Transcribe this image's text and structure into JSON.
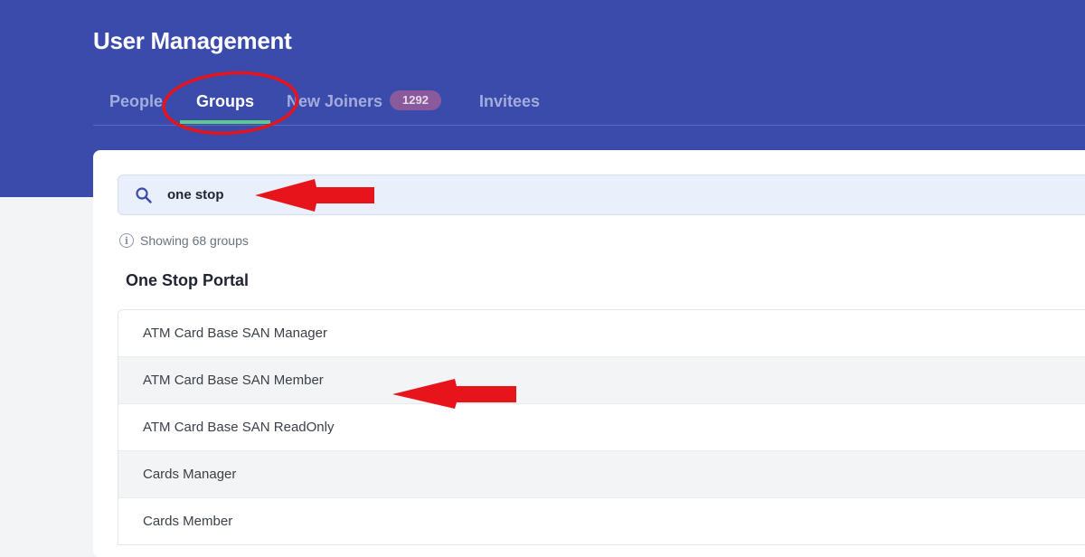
{
  "header": {
    "title": "User Management",
    "tabs": [
      {
        "label": "People",
        "active": false
      },
      {
        "label": "Groups",
        "active": true
      },
      {
        "label": "New Joiners",
        "active": false,
        "badge": "1292"
      },
      {
        "label": "Invitees",
        "active": false
      }
    ]
  },
  "search": {
    "value": "one stop",
    "icon": "search-icon"
  },
  "results": {
    "info_text": "Showing 68 groups",
    "section_title": "One Stop Portal",
    "items": [
      "ATM Card Base SAN Manager",
      "ATM Card Base SAN Member",
      "ATM Card Base SAN ReadOnly",
      "Cards Manager",
      "Cards Member"
    ]
  },
  "colors": {
    "header_bg": "#3a4bab",
    "tab_active_underline": "#5fc98a",
    "badge_bg": "#8a5a9c",
    "annotation": "#e8141c"
  }
}
